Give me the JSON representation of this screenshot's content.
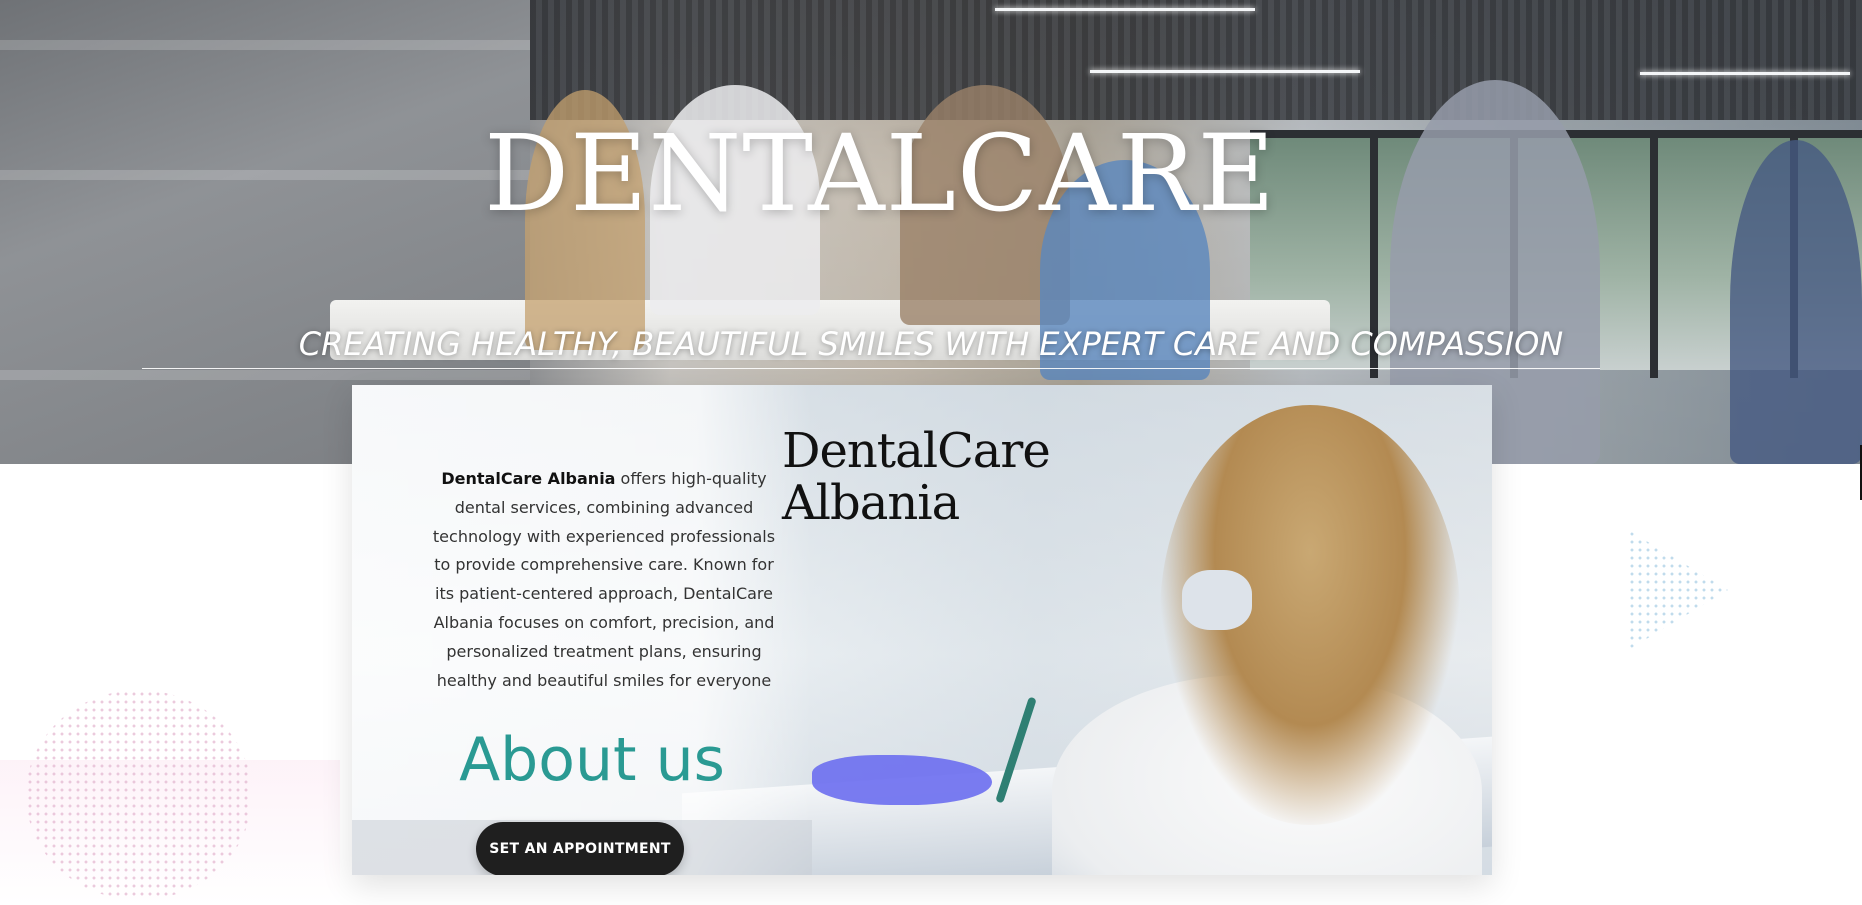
{
  "hero": {
    "title": "DENTALCARE",
    "tagline": "CREATING HEALTHY, BEAUTIFUL SMILES WITH EXPERT CARE AND COMPASSION"
  },
  "about": {
    "intro_brand": "DentalCare Albania",
    "intro_text": " offers high-quality dental services, combining advanced technology with experienced professionals to provide comprehensive care. Known for its patient-centered approach, DentalCare Albania focuses on comfort, precision, and personalized treatment plans, ensuring healthy and beautiful smiles for everyone",
    "heading": "About us",
    "brand_line1": "DentalCare",
    "brand_line2": "Albania",
    "button_label": "SET AN APPOINTMENT"
  },
  "colors": {
    "accent_teal": "#2a9a93",
    "button_dark": "#1f1f1f",
    "hero_text": "#ffffff"
  }
}
